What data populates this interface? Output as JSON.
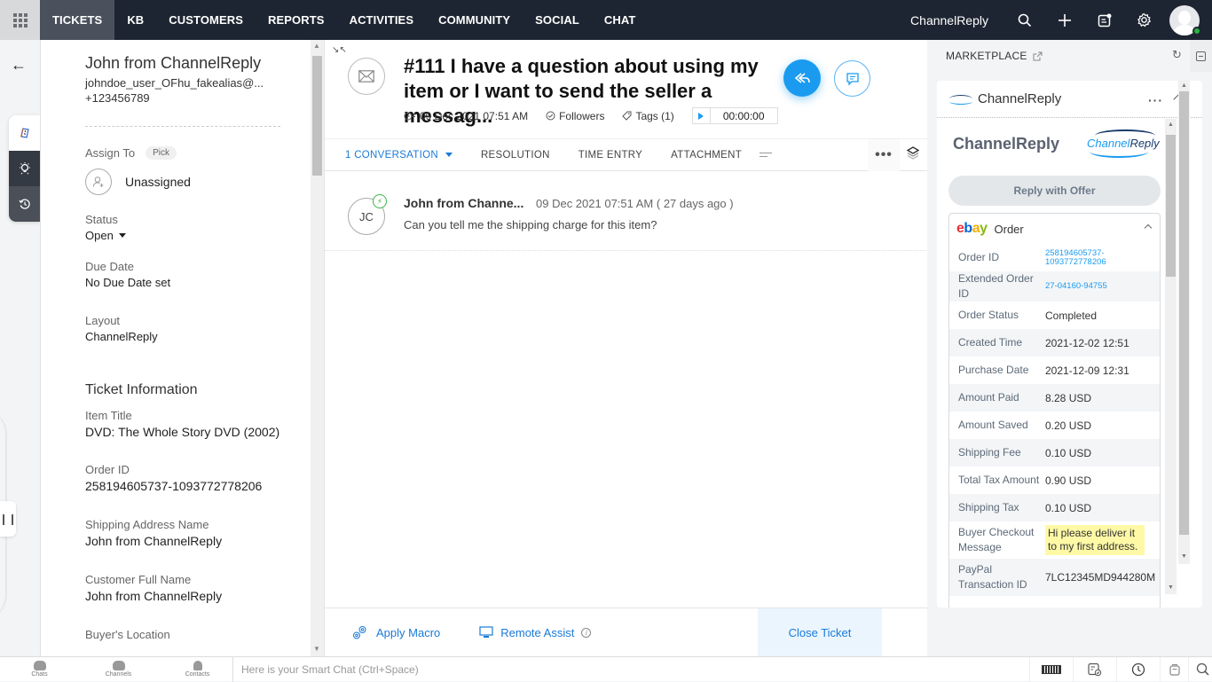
{
  "topnav": {
    "tabs": [
      {
        "label": "TICKETS",
        "active": true
      },
      {
        "label": "KB"
      },
      {
        "label": "CUSTOMERS"
      },
      {
        "label": "REPORTS"
      },
      {
        "label": "ACTIVITIES"
      },
      {
        "label": "COMMUNITY"
      },
      {
        "label": "SOCIAL"
      },
      {
        "label": "CHAT"
      }
    ],
    "brand": "ChannelReply",
    "icons": [
      "search-icon",
      "plus-icon",
      "notes-icon",
      "gear-icon",
      "avatar"
    ]
  },
  "contact": {
    "name": "John from ChannelReply",
    "email": "johndoe_user_OFhu_fakealias@...",
    "phone": "+123456789"
  },
  "properties": {
    "assign_label": "Assign To",
    "pick_label": "Pick",
    "assignee": "Unassigned",
    "status_label": "Status",
    "status_value": "Open",
    "due_label": "Due Date",
    "due_value": "No Due Date set",
    "layout_label": "Layout",
    "layout_value": "ChannelReply",
    "section_title": "Ticket Information",
    "fields": [
      {
        "label": "Item Title",
        "value": "DVD: The Whole Story DVD (2002)"
      },
      {
        "label": "Order ID",
        "value": "258194605737-1093772778206"
      },
      {
        "label": "Shipping Address Name",
        "value": "John from ChannelReply"
      },
      {
        "label": "Customer Full Name",
        "value": "John from ChannelReply"
      },
      {
        "label": "Buyer's Location",
        "value": ""
      }
    ]
  },
  "ticket": {
    "title": "#111  I have a question about using my item or I want to send the seller a messag...",
    "created": "09 Dec 2021 07:51 AM",
    "followers": "Followers",
    "tags": "Tags (1)",
    "timer": "00:00:00"
  },
  "tabs": {
    "conversation": "1 CONVERSATION",
    "resolution": "RESOLUTION",
    "time_entry": "TIME ENTRY",
    "attachment": "ATTACHMENT"
  },
  "thread": {
    "initials": "JC",
    "from": "John from Channe...",
    "time": "09 Dec 2021 07:51 AM ( 27 days ago )",
    "body": "Can you tell me the shipping charge for this item?"
  },
  "actions": {
    "apply_macro": "Apply Macro",
    "remote_assist": "Remote Assist",
    "close_ticket": "Close Ticket"
  },
  "marketplace": {
    "title": "MARKETPLACE",
    "widget_name": "ChannelReply",
    "app_title": "ChannelReply",
    "logo_text_a": "Channel",
    "logo_text_b": "Reply",
    "reply_offer": "Reply with Offer",
    "order_label": "Order",
    "ebay": {
      "e": "e",
      "b": "b",
      "a": "a",
      "y": "y"
    },
    "order_rows": [
      {
        "key": "Order ID",
        "value": "258194605737-\n1093772778206",
        "link": true
      },
      {
        "key": "Extended Order ID",
        "value": "27-04160-94755",
        "link": true
      },
      {
        "key": "Order Status",
        "value": "Completed"
      },
      {
        "key": "Created Time",
        "value": "2021-12-02 12:51"
      },
      {
        "key": "Purchase Date",
        "value": "2021-12-09 12:31"
      },
      {
        "key": "Amount Paid",
        "value": "8.28 USD"
      },
      {
        "key": "Amount Saved",
        "value": "0.20 USD"
      },
      {
        "key": "Shipping Fee",
        "value": "0.10 USD"
      },
      {
        "key": "Total Tax Amount",
        "value": "0.90 USD"
      },
      {
        "key": "Shipping Tax",
        "value": "0.10 USD"
      },
      {
        "key": "Buyer Checkout Message",
        "value": "Hi please deliver it to my first address.",
        "highlight": true
      },
      {
        "key": "PayPal Transaction ID",
        "value": "7LC12345MD944280M"
      }
    ]
  },
  "bottombar": {
    "chats": "Chats",
    "channels": "Channels",
    "contacts": "Contacts",
    "smart_chat_placeholder": "Here is your Smart Chat (Ctrl+Space)"
  }
}
